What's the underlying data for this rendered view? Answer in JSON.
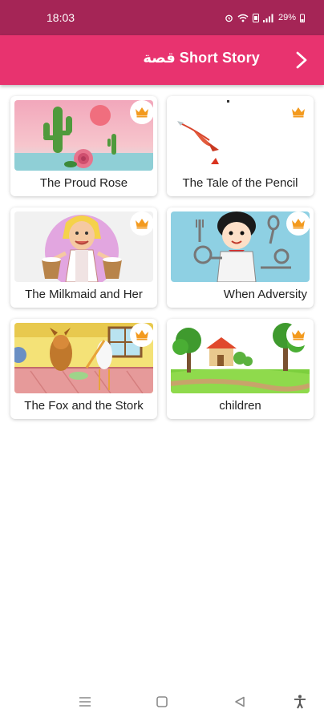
{
  "status_bar": {
    "time": "18:03",
    "battery": "29%"
  },
  "app_bar": {
    "title": "قصة Short Story"
  },
  "stories": [
    {
      "title": "The Proud Rose",
      "premium": true
    },
    {
      "title": "The Tale of the Pencil",
      "premium": true
    },
    {
      "title": "The Milkmaid and Her",
      "premium": true
    },
    {
      "title": "When Adversity",
      "premium": true
    },
    {
      "title": "The Fox and the Stork",
      "premium": true
    },
    {
      "title": "children",
      "premium": true
    }
  ],
  "colors": {
    "status_bar": "#a52556",
    "app_bar": "#e8336f",
    "crown": "#f39a1e"
  },
  "icons": {
    "back": "chevron-right-icon",
    "premium": "crown-icon",
    "nav": [
      "menu-icon",
      "home-square-icon",
      "back-triangle-icon",
      "accessibility-icon"
    ]
  }
}
